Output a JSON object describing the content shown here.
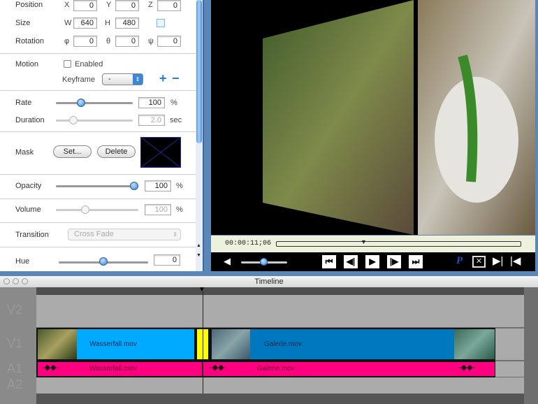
{
  "inspector": {
    "position": {
      "label": "Position",
      "x_label": "X",
      "x": "0",
      "y_label": "Y",
      "y": "0",
      "z_label": "Z",
      "z": "0"
    },
    "size": {
      "label": "Size",
      "w_label": "W",
      "w": "640",
      "h_label": "H",
      "h": "480"
    },
    "rotation": {
      "label": "Rotation",
      "a_label": "φ",
      "a": "0",
      "b_label": "θ",
      "b": "0",
      "c_label": "ψ",
      "c": "0"
    },
    "motion": {
      "label": "Motion",
      "enabled_label": "Enabled",
      "enabled": false,
      "keyframe_label": "Keyframe",
      "keyframe_value": "-",
      "add": "+",
      "remove": "−"
    },
    "rate": {
      "label": "Rate",
      "value": "100",
      "unit": "%",
      "slider_pct": 30
    },
    "duration": {
      "label": "Duration",
      "value": "2.0",
      "unit": "sec",
      "slider_pct": 20
    },
    "mask": {
      "label": "Mask",
      "set_label": "Set...",
      "delete_label": "Delete"
    },
    "opacity": {
      "label": "Opacity",
      "value": "100",
      "unit": "%",
      "slider_pct": 100
    },
    "volume": {
      "label": "Volume",
      "value": "100",
      "unit": "%",
      "slider_pct": 35
    },
    "transition": {
      "label": "Transition",
      "value": "Cross Fade"
    },
    "hue": {
      "label": "Hue",
      "value": "0",
      "slider_pct": 50
    }
  },
  "viewer": {
    "timecode": "00:00:11;06",
    "playhead_pct": 34,
    "volume_pct": 45,
    "p_label": "P"
  },
  "timeline": {
    "title": "Timeline",
    "tracks": [
      "V2",
      "V1",
      "A1",
      "A2"
    ],
    "clips": {
      "v1_a": "Wasserfall.mov",
      "v1_b": "Galerie.mov",
      "a1_a": "Wasserfall.mov",
      "a1_b": "Galerie.mov"
    },
    "colors": {
      "video_a": "#00aaff",
      "video_b": "#0078bf",
      "transition": "#ffff00",
      "audio": "#ff0080"
    }
  }
}
